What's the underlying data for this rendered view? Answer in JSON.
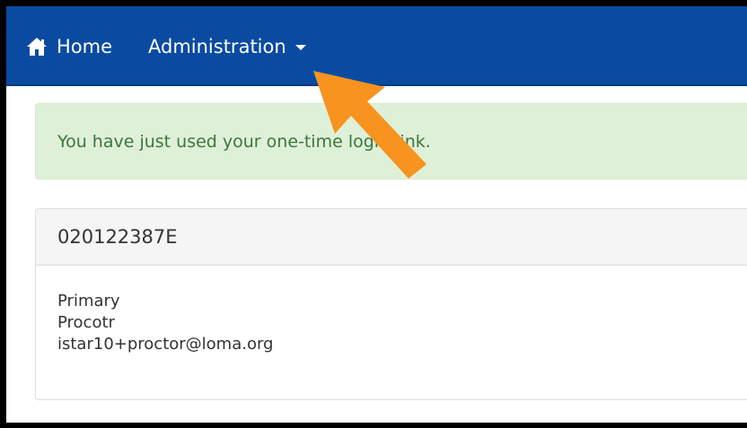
{
  "navbar": {
    "background": "#0a4ba1",
    "home_label": "Home",
    "admin_label": "Administration",
    "home_icon": "home-icon",
    "caret_icon": "caret-down-icon"
  },
  "alert": {
    "message": "You have just used your one-time login link.",
    "color": "#3c763d",
    "background": "#dff0d8"
  },
  "panel": {
    "title": "020122387E",
    "lines": [
      "Primary",
      "Procotr",
      "istar10+proctor@loma.org"
    ]
  },
  "annotation": {
    "arrow_color": "#f7931e",
    "icon": "pointer-arrow-icon"
  }
}
